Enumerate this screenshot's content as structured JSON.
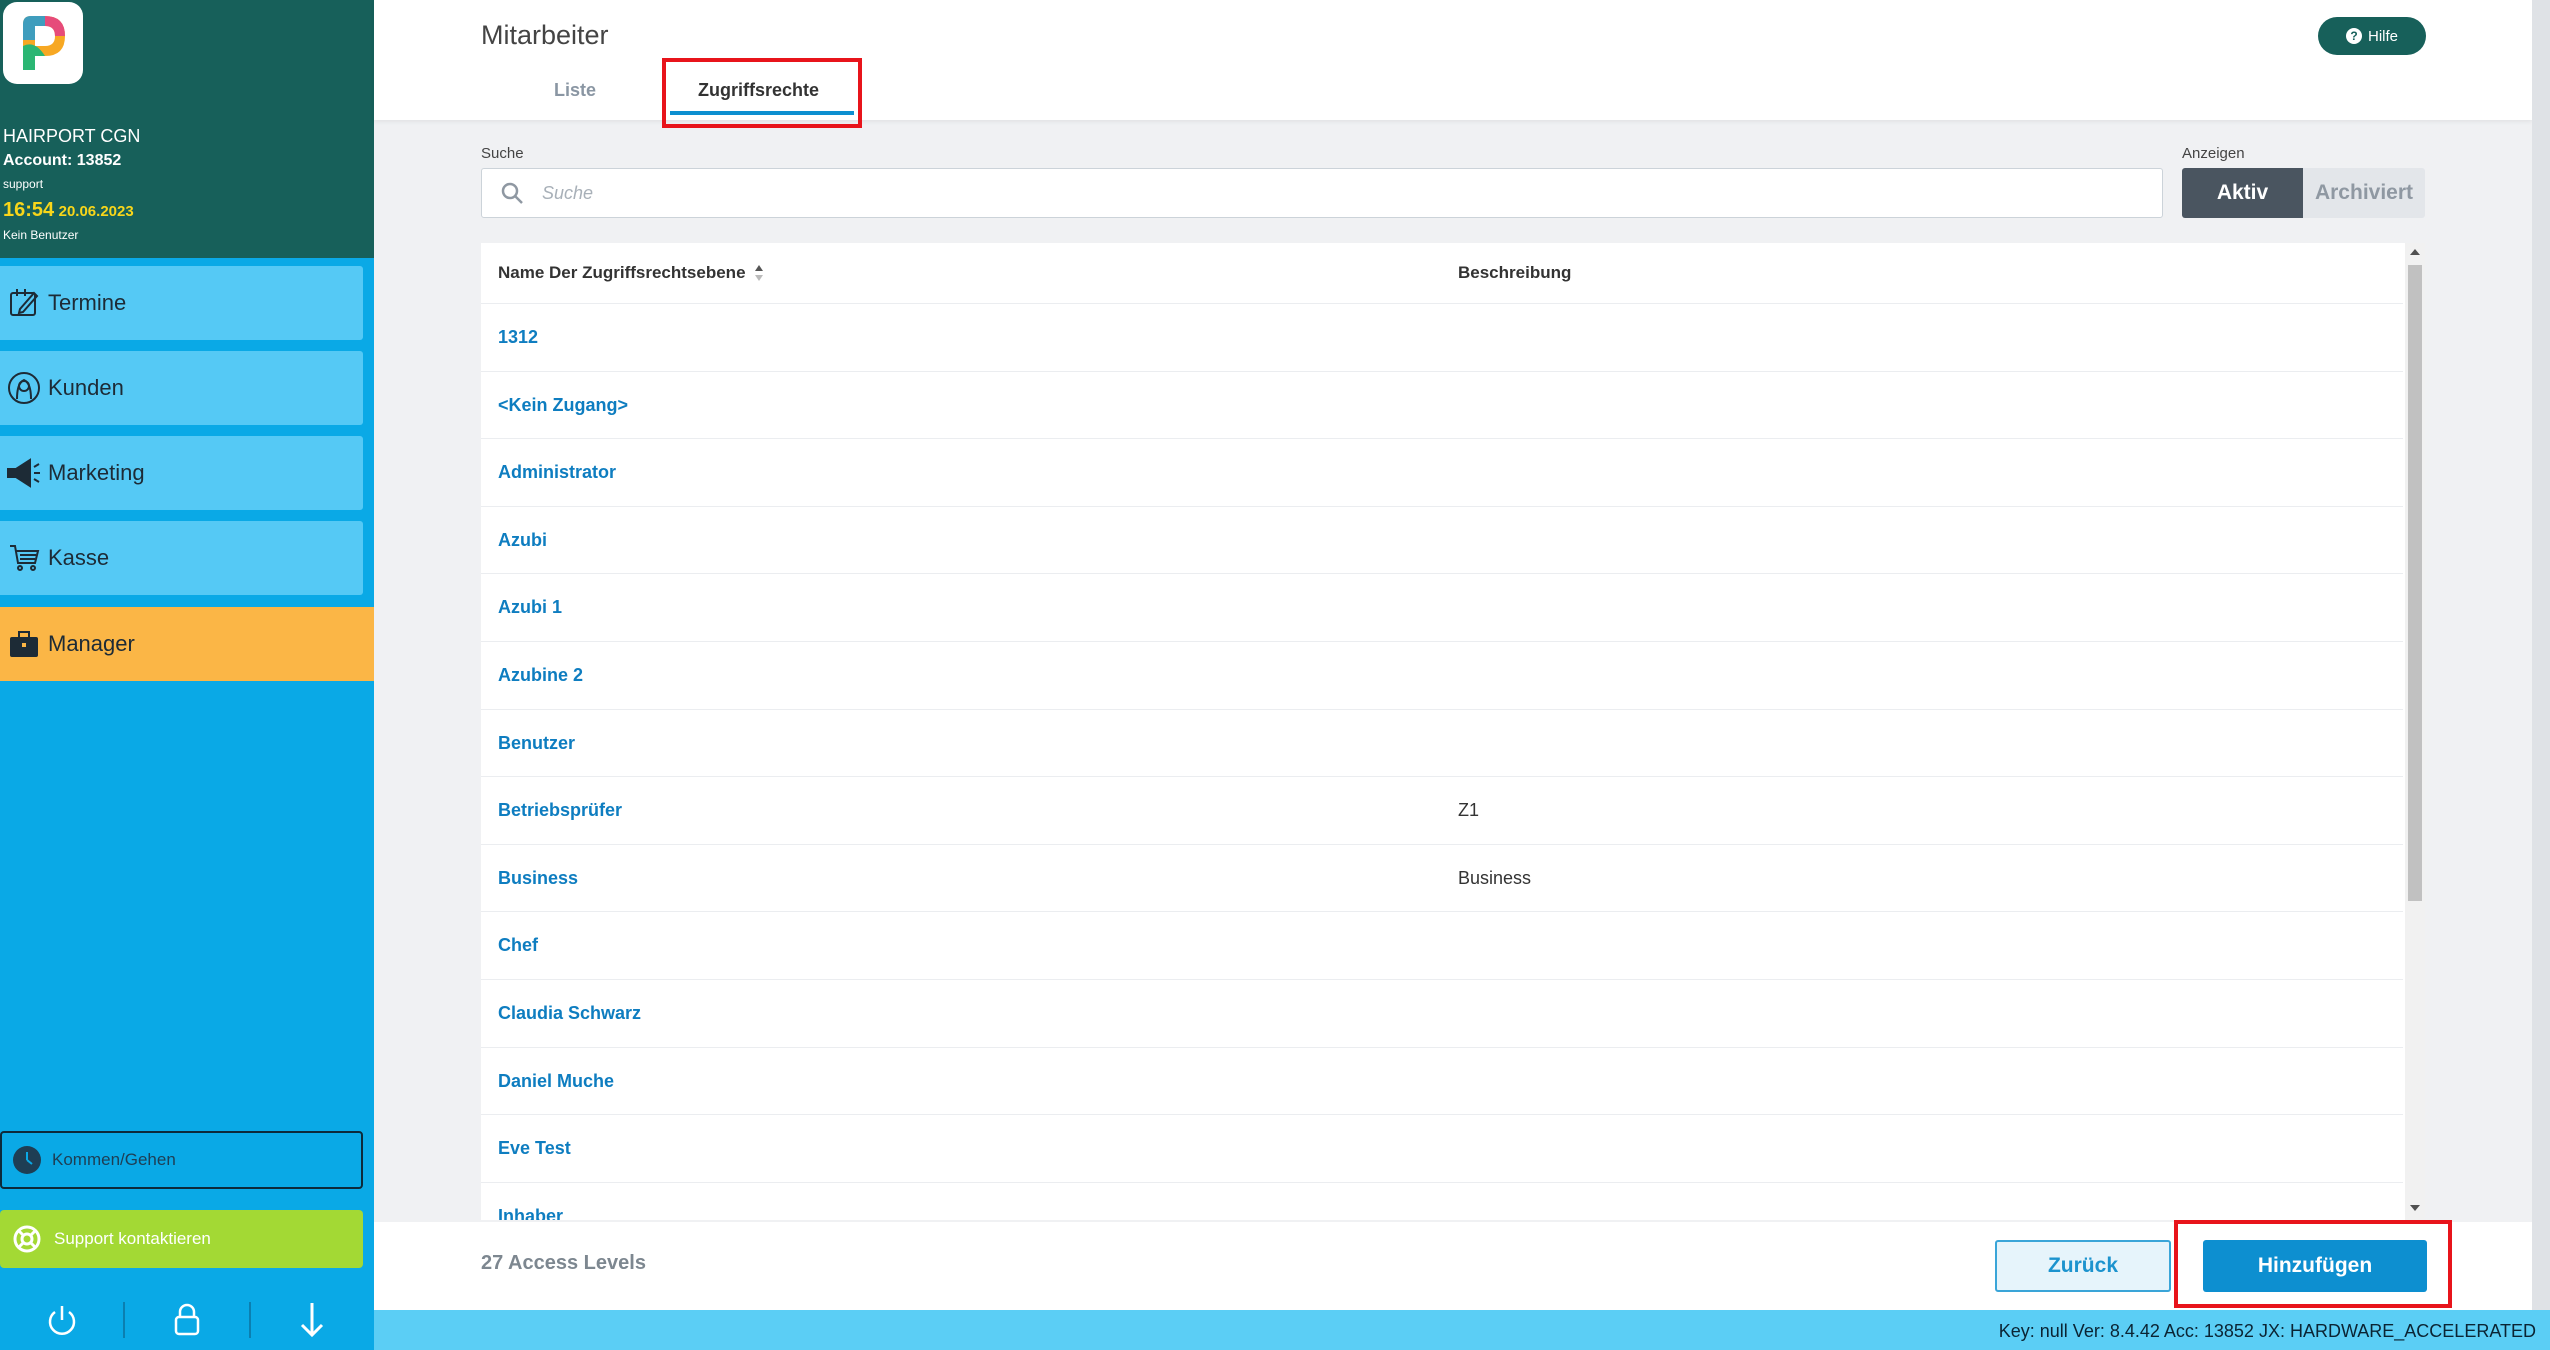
{
  "account": {
    "salon": "HAIRPORT CGN",
    "account_line": "Account: 13852",
    "user": "support",
    "time": "16:54",
    "date": "20.06.2023",
    "no_user": "Kein Benutzer"
  },
  "nav": {
    "items": [
      {
        "label": "Termine",
        "icon": "calendar-icon"
      },
      {
        "label": "Kunden",
        "icon": "customer-icon"
      },
      {
        "label": "Marketing",
        "icon": "megaphone-icon"
      },
      {
        "label": "Kasse",
        "icon": "cart-icon"
      },
      {
        "label": "Manager",
        "icon": "briefcase-icon",
        "active": true
      }
    ],
    "kommen_gehen": "Kommen/Gehen",
    "support": "Support kontaktieren"
  },
  "header": {
    "title": "Mitarbeiter",
    "help": "Hilfe",
    "tabs": [
      {
        "label": "Liste",
        "active": false
      },
      {
        "label": "Zugriffsrechte",
        "active": true
      }
    ]
  },
  "search": {
    "label": "Suche",
    "placeholder": "Suche",
    "value": ""
  },
  "filter": {
    "label": "Anzeigen",
    "options": [
      "Aktiv",
      "Archiviert"
    ],
    "selected": "Aktiv"
  },
  "table": {
    "columns": [
      "Name Der Zugriffsrechtsebene",
      "Beschreibung"
    ],
    "rows": [
      {
        "name": "1312",
        "desc": ""
      },
      {
        "name": "<Kein Zugang>",
        "desc": ""
      },
      {
        "name": "Administrator",
        "desc": ""
      },
      {
        "name": "Azubi",
        "desc": ""
      },
      {
        "name": "Azubi 1",
        "desc": ""
      },
      {
        "name": "Azubine 2",
        "desc": ""
      },
      {
        "name": "Benutzer",
        "desc": ""
      },
      {
        "name": "Betriebsprüfer",
        "desc": "Z1"
      },
      {
        "name": "Business",
        "desc": "Business"
      },
      {
        "name": "Chef",
        "desc": ""
      },
      {
        "name": "Claudia Schwarz",
        "desc": ""
      },
      {
        "name": "Daniel Muche",
        "desc": ""
      },
      {
        "name": "Eve Test",
        "desc": ""
      },
      {
        "name": "Inhaber",
        "desc": ""
      }
    ]
  },
  "footer": {
    "count": "27 Access Levels",
    "back": "Zurück",
    "add": "Hinzufügen"
  },
  "status": {
    "text": "Key: null Ver: 8.4.42 Acc: 13852  JX: HARDWARE_ACCELERATED"
  },
  "colors": {
    "sidebar_header": "#17605a",
    "sidebar": "#0aa9e6",
    "nav_item": "#55c9f5",
    "nav_active": "#fbb646",
    "accent": "#0d8fd0",
    "highlight": "#e8141b",
    "support": "#a3d934"
  }
}
